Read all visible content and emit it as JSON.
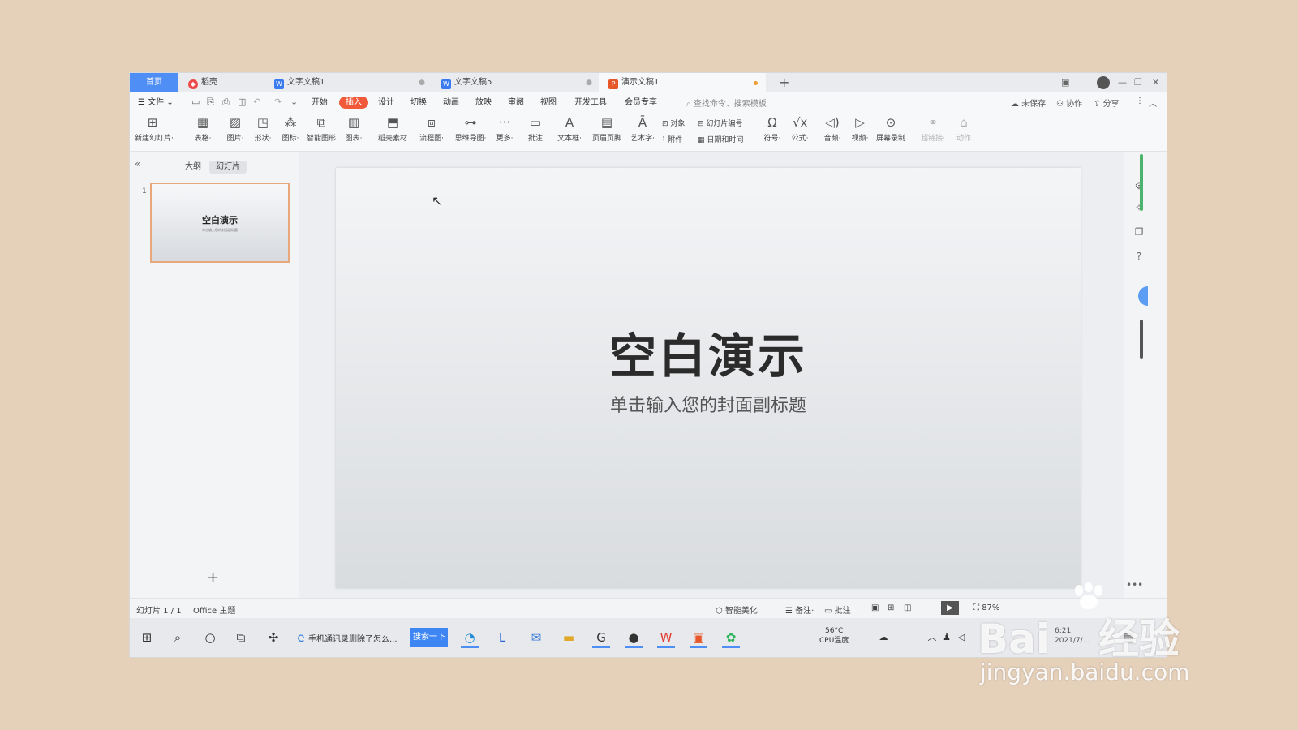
{
  "titlebar": {
    "tabs": [
      {
        "label": "首页",
        "color": "#4f8ef5"
      },
      {
        "label": "稻壳",
        "icon": "docer-icon",
        "icon_color": "#ef4a4a"
      },
      {
        "label": "文字文稿1",
        "icon": "writer-icon",
        "icon_color": "#3a7bf0"
      },
      {
        "label": "文字文稿5",
        "icon": "writer-icon",
        "icon_color": "#3a7bf0"
      },
      {
        "label": "演示文稿1",
        "icon": "presentation-icon",
        "icon_color": "#e8572a",
        "unsaved": true
      }
    ],
    "new_tab": "+"
  },
  "menubar": {
    "file": "文件",
    "items": [
      "开始",
      "插入",
      "设计",
      "切换",
      "动画",
      "放映",
      "审阅",
      "视图",
      "开发工具",
      "会员专享"
    ],
    "active_item": "插入",
    "active_color": "#f0593a",
    "search_placeholder": "查找命令、搜索模板",
    "unsaved": "未保存",
    "collaborate": "协作",
    "share": "分享"
  },
  "ribbon": {
    "tools": [
      {
        "label": "新建幻灯片·",
        "icon": "new-slide-icon"
      },
      {
        "label": "表格·",
        "icon": "table-icon"
      },
      {
        "label": "图片·",
        "icon": "picture-icon"
      },
      {
        "label": "形状·",
        "icon": "shape-icon"
      },
      {
        "label": "图标·",
        "icon": "icons-icon"
      },
      {
        "label": "智能图形",
        "icon": "smartart-icon"
      },
      {
        "label": "图表·",
        "icon": "chart-icon"
      },
      {
        "label": "稻壳素材",
        "icon": "material-icon"
      },
      {
        "label": "流程图·",
        "icon": "flowchart-icon"
      },
      {
        "label": "思维导图·",
        "icon": "mindmap-icon"
      },
      {
        "label": "更多·",
        "icon": "more-icon"
      },
      {
        "label": "批注",
        "icon": "comment-icon"
      },
      {
        "label": "文本框·",
        "icon": "textbox-icon"
      },
      {
        "label": "页眉页脚",
        "icon": "header-footer-icon"
      },
      {
        "label": "艺术字·",
        "icon": "wordart-icon"
      },
      {
        "label": "符号·",
        "icon": "symbol-icon"
      },
      {
        "label": "公式·",
        "icon": "formula-icon"
      },
      {
        "label": "音频·",
        "icon": "audio-icon"
      },
      {
        "label": "视频·",
        "icon": "video-icon"
      },
      {
        "label": "屏幕录制",
        "icon": "screen-record-icon"
      },
      {
        "label": "超链接·",
        "icon": "hyperlink-icon"
      },
      {
        "label": "动作",
        "icon": "action-icon"
      }
    ],
    "small_tools": {
      "object": "对象",
      "slide_number": "幻灯片编号",
      "attachment": "附件",
      "date_time": "日期和时间"
    }
  },
  "left_panel": {
    "tabs": [
      "大纲",
      "幻灯片"
    ],
    "active_tab": "幻灯片",
    "slide_number": "1",
    "thumbnail_title": "空白演示",
    "thumbnail_subtitle": "单击输入您的封面副标题",
    "add": "+"
  },
  "slide": {
    "title": "空白演示",
    "subtitle": "单击输入您的封面副标题"
  },
  "statusbar": {
    "slide_count": "幻灯片 1 / 1",
    "theme": "Office 主题",
    "beautify": "智能美化·",
    "notes": "备注·",
    "comments": "批注",
    "zoom": "87%"
  },
  "taskbar": {
    "ie_text": "手机通讯录删除了怎么...",
    "search_button": "搜索一下",
    "temperature": "56°C",
    "cpu_label": "CPU温度",
    "time": "6:21",
    "date": "2021/7/..."
  },
  "watermark": {
    "logo": "Bai",
    "logo_cn": "经验",
    "url": "jingyan.baidu.com"
  }
}
